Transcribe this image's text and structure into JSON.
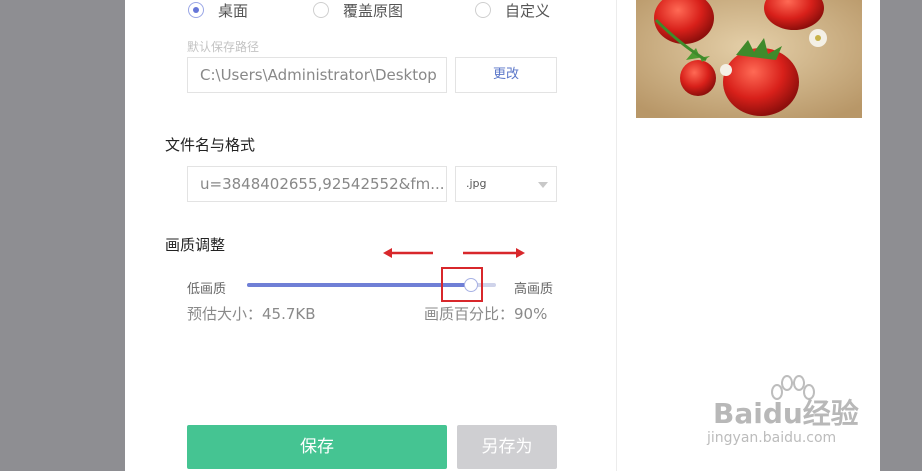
{
  "save_location": {
    "options": [
      {
        "label": "桌面",
        "checked": true
      },
      {
        "label": "覆盖原图",
        "checked": false
      },
      {
        "label": "自定义",
        "checked": false
      }
    ],
    "default_path_label": "默认保存路径",
    "path_value": "C:\\Users\\Administrator\\Desktop",
    "change_button": "更改"
  },
  "filename_format": {
    "title": "文件名与格式",
    "filename_value": "u=3848402655,92542552&fm...",
    "format_value": ".jpg"
  },
  "quality": {
    "title": "画质调整",
    "low_label": "低画质",
    "high_label": "高画质",
    "level_percent": 90,
    "estimated_size": "预估大小：45.7KB",
    "quality_percent": "画质百分比：90%"
  },
  "actions": {
    "save": "保存",
    "save_as": "另存为"
  },
  "watermark": {
    "brand": "Baidu经验",
    "url": "jingyan.baidu.com"
  },
  "colors": {
    "save_button": "#45c492",
    "slider_fill": "#6f7fd6",
    "annotation": "#d8272b"
  }
}
